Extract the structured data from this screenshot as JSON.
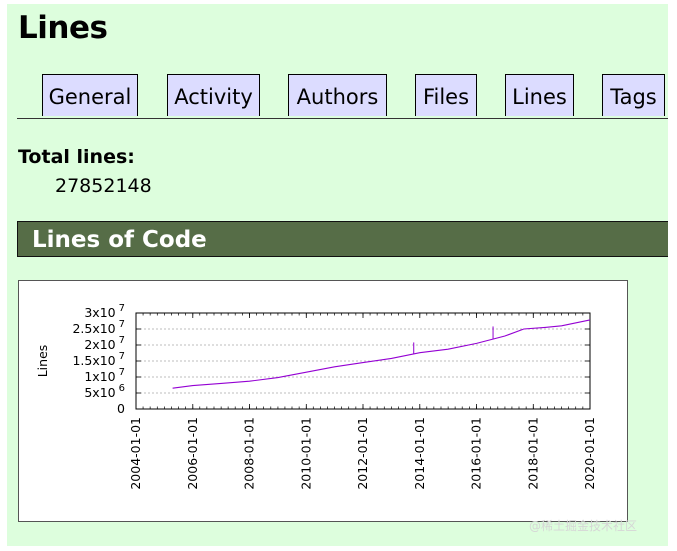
{
  "page": {
    "title": "Lines"
  },
  "tabs": [
    {
      "label": "General"
    },
    {
      "label": "Activity"
    },
    {
      "label": "Authors"
    },
    {
      "label": "Files"
    },
    {
      "label": "Lines"
    },
    {
      "label": "Tags"
    }
  ],
  "summary": {
    "total_label": "Total lines:",
    "total_value": "27852148"
  },
  "section": {
    "title": "Lines of Code"
  },
  "watermark": "@稀土掘金技术社区",
  "colors": {
    "page_background": "#ddfedd",
    "tab_background": "#dcdcff",
    "section_header": "#566d47",
    "series_line": "#9400d3"
  },
  "chart_data": {
    "type": "line",
    "title": "",
    "xlabel": "",
    "ylabel": "Lines",
    "grid": true,
    "xlim": [
      "2004-01-01",
      "2020-01-01"
    ],
    "ylim": [
      0,
      30000000
    ],
    "x_ticks": [
      "2004-01-01",
      "2006-01-01",
      "2008-01-01",
      "2010-01-01",
      "2012-01-01",
      "2014-01-01",
      "2016-01-01",
      "2018-01-01",
      "2020-01-01"
    ],
    "y_ticks": [
      {
        "value": 0,
        "base": "0",
        "exp": ""
      },
      {
        "value": 5000000,
        "base": "5x10",
        "exp": "6"
      },
      {
        "value": 10000000,
        "base": "1x10",
        "exp": "7"
      },
      {
        "value": 15000000,
        "base": "1.5x10",
        "exp": "7"
      },
      {
        "value": 20000000,
        "base": "2x10",
        "exp": "7"
      },
      {
        "value": 25000000,
        "base": "2.5x10",
        "exp": "7"
      },
      {
        "value": 30000000,
        "base": "3x10",
        "exp": "7"
      }
    ],
    "series": [
      {
        "x": [
          "2005-04-16",
          "2006-01-01",
          "2007-01-01",
          "2008-01-01",
          "2009-01-01",
          "2010-01-01",
          "2011-01-01",
          "2012-01-01",
          "2013-01-01",
          "2014-01-01",
          "2015-01-01",
          "2016-01-01",
          "2017-01-01",
          "2017-09-01",
          "2018-06-01",
          "2019-01-01",
          "2020-01-01"
        ],
        "y": [
          6500000,
          7300000,
          8000000,
          8700000,
          9800000,
          11500000,
          13200000,
          14500000,
          15800000,
          17600000,
          18700000,
          20500000,
          22800000,
          25000000,
          25500000,
          26000000,
          27852148
        ]
      }
    ],
    "spikes": [
      {
        "x": "2013-10-15",
        "y": 20800000
      },
      {
        "x": "2016-08-01",
        "y": 25800000
      }
    ]
  }
}
